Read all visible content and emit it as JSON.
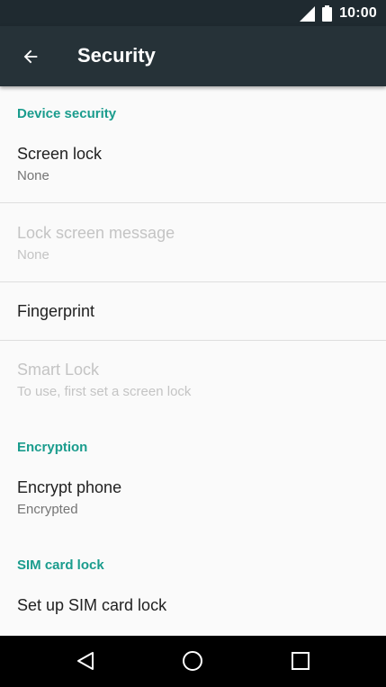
{
  "status_bar": {
    "time": "10:00",
    "icons": [
      "signal-icon",
      "battery-icon"
    ]
  },
  "app_bar": {
    "title": "Security",
    "back_icon": "arrow-back-icon"
  },
  "sections": {
    "device_security": {
      "header": "Device security",
      "items": [
        {
          "title": "Screen lock",
          "subtitle": "None",
          "enabled": true
        },
        {
          "title": "Lock screen message",
          "subtitle": "None",
          "enabled": false
        },
        {
          "title": "Fingerprint",
          "enabled": true
        },
        {
          "title": "Smart Lock",
          "subtitle": "To use, first set a screen lock",
          "enabled": false
        }
      ]
    },
    "encryption": {
      "header": "Encryption",
      "items": [
        {
          "title": "Encrypt phone",
          "subtitle": "Encrypted",
          "enabled": true
        }
      ]
    },
    "sim_card_lock": {
      "header": "SIM card lock",
      "items": [
        {
          "title": "Set up SIM card lock",
          "enabled": true
        }
      ]
    }
  },
  "nav_bar": {
    "buttons": [
      "back-triangle-icon",
      "home-circle-icon",
      "recents-square-icon"
    ]
  },
  "colors": {
    "accent": "#1a9c8d",
    "app_bar": "#263238",
    "status_bar": "#1f2a30"
  }
}
